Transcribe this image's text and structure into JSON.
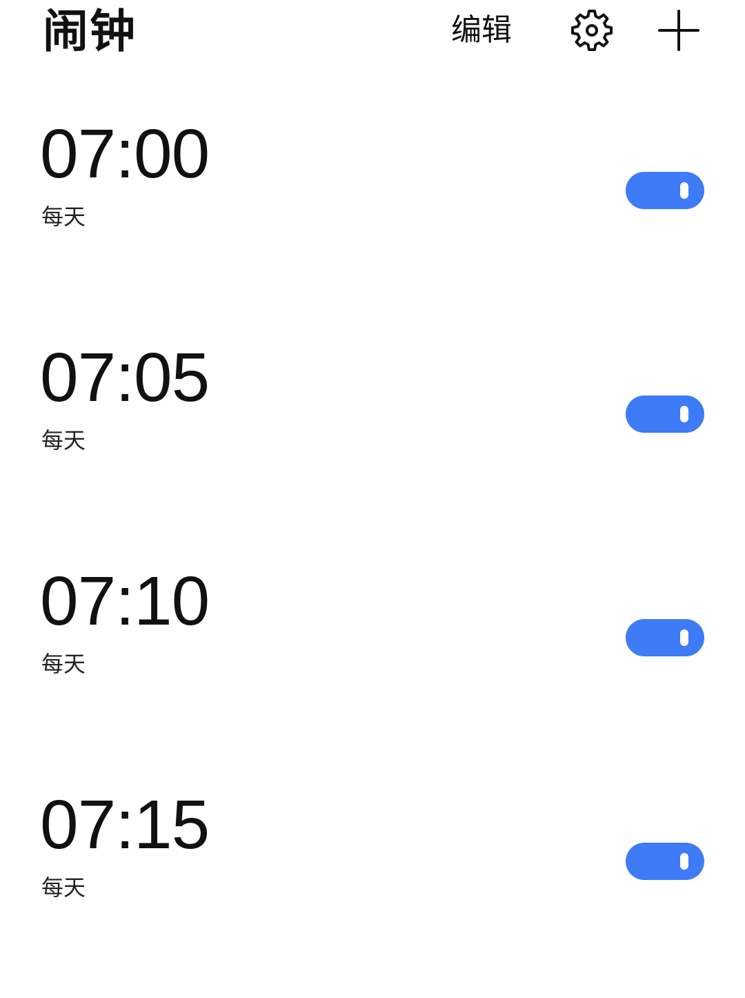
{
  "header": {
    "title": "闹钟",
    "edit_label": "编辑",
    "settings_icon": "gear-icon",
    "add_icon": "plus-icon"
  },
  "colors": {
    "accent": "#3d7bf7",
    "text": "#111111",
    "background": "#ffffff"
  },
  "alarms": [
    {
      "time": "07:00",
      "repeat": "每天",
      "enabled": true
    },
    {
      "time": "07:05",
      "repeat": "每天",
      "enabled": true
    },
    {
      "time": "07:10",
      "repeat": "每天",
      "enabled": true
    },
    {
      "time": "07:15",
      "repeat": "每天",
      "enabled": true
    }
  ]
}
